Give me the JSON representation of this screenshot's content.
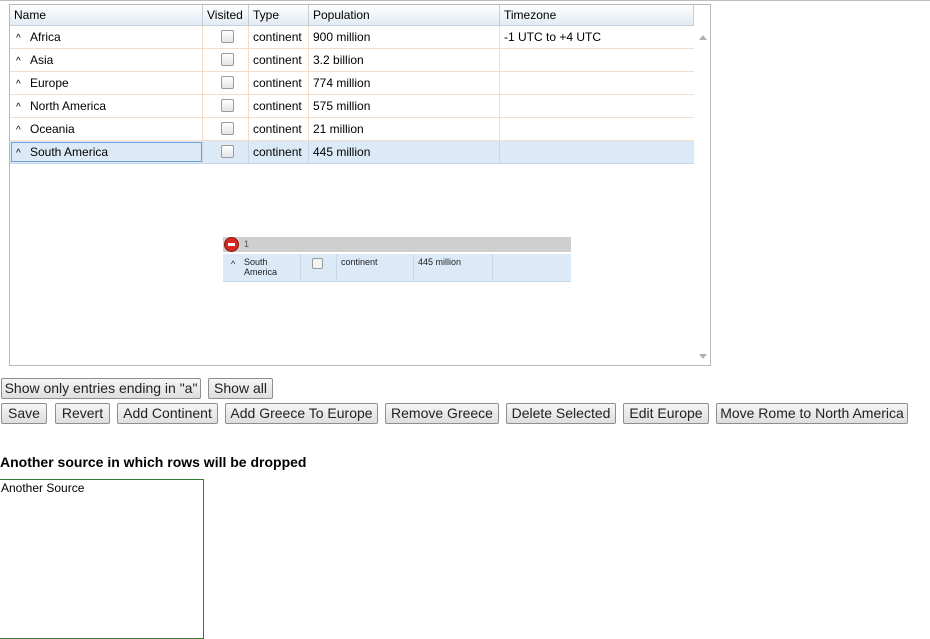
{
  "grid": {
    "columns": [
      "Name",
      "Visited",
      "Type",
      "Population",
      "Timezone"
    ],
    "rows": [
      {
        "name": "Africa",
        "type": "continent",
        "population": "900 million",
        "timezone": "-1 UTC to +4 UTC",
        "visited": false
      },
      {
        "name": "Asia",
        "type": "continent",
        "population": "3.2 billion",
        "timezone": "",
        "visited": false
      },
      {
        "name": "Europe",
        "type": "continent",
        "population": "774 million",
        "timezone": "",
        "visited": false
      },
      {
        "name": "North America",
        "type": "continent",
        "population": "575 million",
        "timezone": "",
        "visited": false
      },
      {
        "name": "Oceania",
        "type": "continent",
        "population": "21 million",
        "timezone": "",
        "visited": false
      },
      {
        "name": "South America",
        "type": "continent",
        "population": "445 million",
        "timezone": "",
        "visited": false,
        "selected": true
      }
    ],
    "expand_glyph": "^"
  },
  "drag_avatar": {
    "count": "1",
    "name": "South America",
    "name_line1": "South",
    "name_line2": "America",
    "type": "continent",
    "population": "445 million",
    "status_icon": "no-drop-icon"
  },
  "buttons_row1": {
    "show_ending_a": "Show only entries ending in \"a\"",
    "show_all": "Show all"
  },
  "buttons_row2": {
    "save": "Save",
    "revert": "Revert",
    "add_continent": "Add Continent",
    "add_greece": "Add Greece To Europe",
    "remove_greece": "Remove Greece",
    "delete_selected": "Delete Selected",
    "edit_europe": "Edit Europe",
    "move_rome": "Move Rome to North America"
  },
  "drop_target": {
    "title": "Another source in which rows will be dropped",
    "label": "Another Source"
  },
  "colors": {
    "selected_row": "#dceaf7",
    "drop_border": "#2e7d32",
    "no_drop": "#d9281f"
  }
}
